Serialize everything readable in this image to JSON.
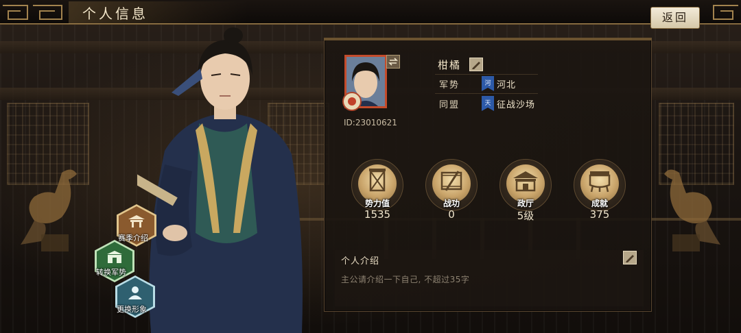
{
  "header": {
    "title": "个人信息",
    "back_label": "返回"
  },
  "profile": {
    "name": "柑橘",
    "id_text": "ID:23010621",
    "faction_label": "军势",
    "faction_flag_char": "河",
    "faction_value": "河北",
    "alliance_label": "同盟",
    "alliance_flag_char": "天",
    "alliance_value": "征战沙场"
  },
  "stats": [
    {
      "label": "势力值",
      "value": "1535",
      "icon": "banner-icon"
    },
    {
      "label": "战功",
      "value": "0",
      "icon": "scroll-sword-icon"
    },
    {
      "label": "政厅",
      "value": "5级",
      "icon": "government-hall-icon"
    },
    {
      "label": "成就",
      "value": "375",
      "icon": "bronze-cauldron-icon"
    }
  ],
  "intro": {
    "title": "个人介绍",
    "placeholder": "主公请介绍一下自己, 不超过35字"
  },
  "side_actions": [
    {
      "label": "赛季介绍",
      "icon": "pavilion-icon",
      "color": "#8a5a2e"
    },
    {
      "label": "转换军势",
      "icon": "gate-icon",
      "color": "#2f6b3a"
    },
    {
      "label": "更换形象",
      "icon": "portrait-icon",
      "color": "#2f6070"
    }
  ],
  "colors": {
    "accent_gold": "#c9a46a",
    "panel_border": "#5a4630",
    "avatar_border": "#c44b2b",
    "flag_blue": "#2d5aa8"
  }
}
